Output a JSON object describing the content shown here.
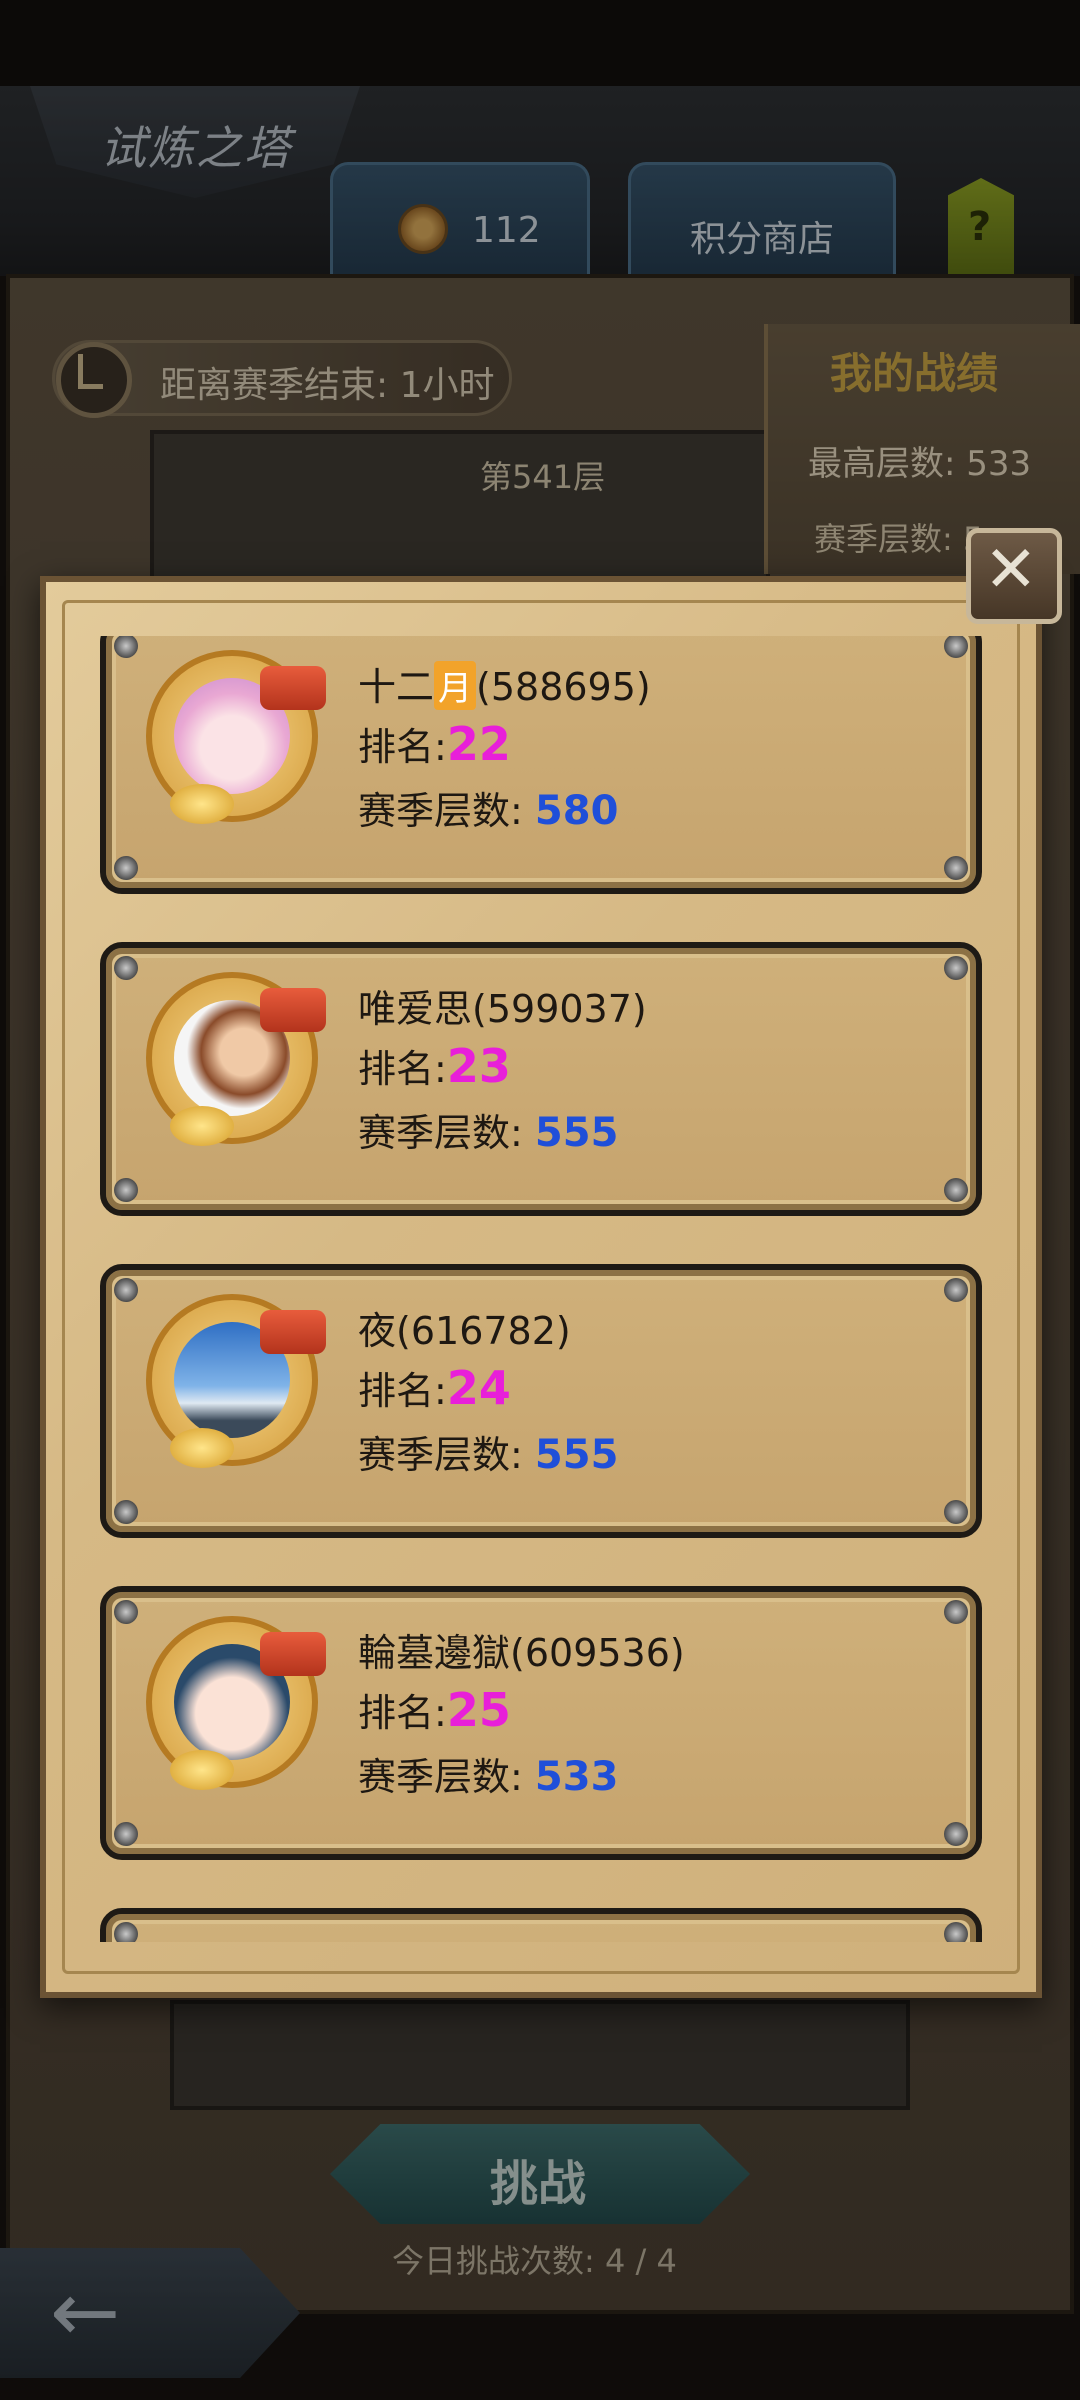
{
  "header": {
    "title": "试炼之塔",
    "points_value": "112",
    "shop_label": "积分商店",
    "help_label": "?"
  },
  "season": {
    "timer_text": "距离赛季结束: 1小时",
    "floor_label": "第541层"
  },
  "my_stats": {
    "title": "我的战绩",
    "best_floor": "最高层数: 533",
    "season_floor_partial": "赛季层数: 5"
  },
  "ranking": {
    "rank_label": "排名:",
    "floor_label": "赛季层数:",
    "entries": [
      {
        "name": "十二",
        "badge": "月",
        "id": "(588695)",
        "rank": "22",
        "floor": "580"
      },
      {
        "name": "唯爱思",
        "badge": "",
        "id": "(599037)",
        "rank": "23",
        "floor": "555"
      },
      {
        "name": "夜",
        "badge": "",
        "id": "(616782)",
        "rank": "24",
        "floor": "555"
      },
      {
        "name": "輪墓邊獄",
        "badge": "",
        "id": "(609536)",
        "rank": "25",
        "floor": "533"
      }
    ]
  },
  "bottom": {
    "challenge_label": "挑战",
    "attempts_text": "今日挑战次数: 4 / 4"
  },
  "icons": {
    "close": "close-icon",
    "back": "back-arrow-icon",
    "clock": "clock-icon",
    "points": "points-icon"
  },
  "colors": {
    "rank_number": "#e81fd9",
    "floor_number": "#1f4fd9",
    "stats_title": "#c7a343"
  }
}
